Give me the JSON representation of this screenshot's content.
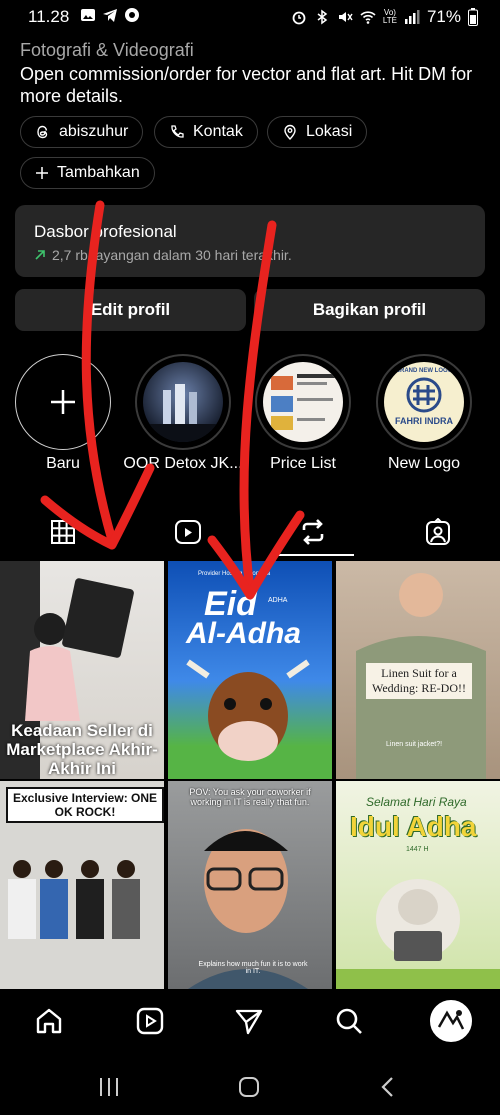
{
  "status_bar": {
    "time": "11.28",
    "battery": "71%",
    "network_top": "Vo)",
    "network_bottom": "LTE"
  },
  "profile": {
    "category": "Fotografi & Videografi",
    "bio": "Open commission/order for vector and flat art. Hit DM for more details.",
    "chips": [
      {
        "label": "abiszuhur",
        "icon": "threads-icon"
      },
      {
        "label": "Kontak",
        "icon": "phone-icon"
      },
      {
        "label": "Lokasi",
        "icon": "location-pin-icon"
      }
    ],
    "add_chip": {
      "label": "Tambahkan",
      "icon": "plus-icon"
    }
  },
  "dashboard": {
    "title": "Dasbor profesional",
    "subtitle": "2,7 rb tayangan dalam 30 hari terakhir."
  },
  "actions": {
    "edit": "Edit profil",
    "share": "Bagikan profil"
  },
  "highlights": [
    {
      "label": "Baru",
      "icon": "plus-icon"
    },
    {
      "label": "OOR Detox JK..."
    },
    {
      "label": "Price List"
    },
    {
      "label": "New Logo",
      "thumb_text_top": "BRAND NEW LOGO",
      "thumb_text_bottom": "FAHRI INDRA"
    }
  ],
  "tabs": [
    {
      "name": "grid-icon"
    },
    {
      "name": "reels-icon"
    },
    {
      "name": "repost-icon",
      "active": true
    },
    {
      "name": "tagged-icon"
    }
  ],
  "posts": [
    {
      "caption": "Keadaan Seller di Marketplace Akhir-Akhir Ini"
    },
    {
      "title_top": "Eid",
      "title_small": "ADHA",
      "title_bottom": "Al-Adha",
      "header": "Provider Hosting Indonesia"
    },
    {
      "caption": "Linen Suit for a Wedding: RE-DO!!",
      "sub": "Linen suit jacket?!"
    },
    {
      "caption": "Exclusive Interview: ONE OK ROCK!"
    },
    {
      "caption": "POV: You ask your coworker if working in IT is really that fun.",
      "sub": "Explains how much fun it is to work in IT."
    },
    {
      "title_small": "Selamat Hari Raya",
      "title_big": "Idul Adha",
      "year": "1447 H"
    }
  ],
  "bottom_nav": [
    {
      "name": "home-icon"
    },
    {
      "name": "reels-icon"
    },
    {
      "name": "direct-message-icon"
    },
    {
      "name": "search-icon"
    },
    {
      "name": "profile-avatar"
    }
  ],
  "colors": {
    "background": "#000000",
    "card": "#262626",
    "muted_text": "#a8a8a8",
    "growth_arrow": "#3ec46d",
    "annotation": "#e8231f"
  }
}
